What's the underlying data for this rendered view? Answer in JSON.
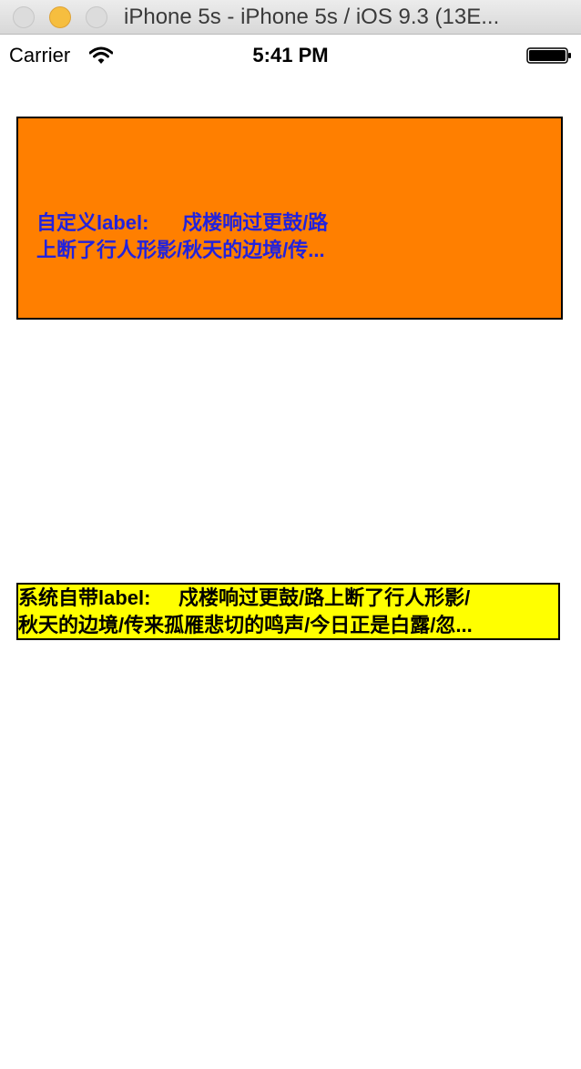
{
  "window": {
    "title": "iPhone 5s - iPhone 5s / iOS 9.3 (13E..."
  },
  "statusbar": {
    "carrier": "Carrier",
    "time": "5:41 PM",
    "icons": [
      "wifi-icon",
      "battery-icon"
    ]
  },
  "custom_label": {
    "line1": "自定义label:      戍楼响过更鼓/路",
    "line2": "上断了行人形影/秋天的边境/传...",
    "background": "#ff7f00",
    "text_color": "#2222dd"
  },
  "system_label": {
    "line1": "系统自带label:     戍楼响过更鼓/路上断了行人形影/",
    "line2": "秋天的边境/传来孤雁悲切的鸣声/今日正是白露/忽...",
    "background": "#ffff00",
    "text_color": "#000000"
  }
}
